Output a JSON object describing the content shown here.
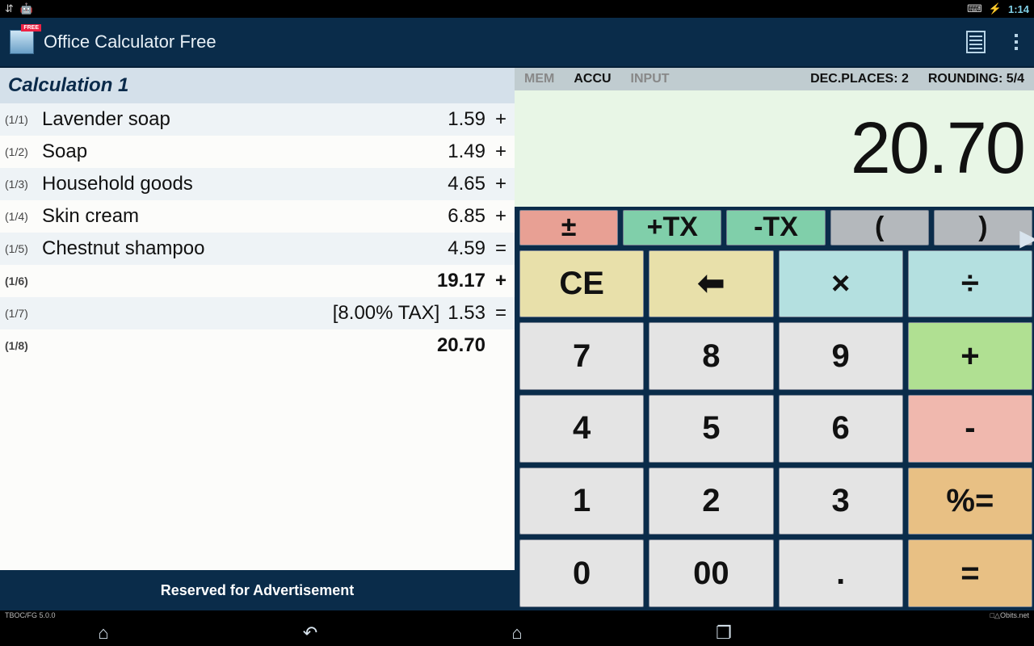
{
  "status": {
    "time": "1:14"
  },
  "appbar": {
    "title": "Office Calculator Free",
    "free_badge": "FREE"
  },
  "info": {
    "mem": "MEM",
    "accu": "ACCU",
    "input": "INPUT",
    "dec": "DEC.PLACES: 2",
    "rounding": "ROUNDING: 5/4"
  },
  "display": {
    "value": "20.70"
  },
  "tape": {
    "title": "Calculation 1",
    "rows": [
      {
        "idx": "(1/1)",
        "label": "Lavender soap",
        "note": "",
        "value": "1.59",
        "op": "+",
        "bold": false
      },
      {
        "idx": "(1/2)",
        "label": "Soap",
        "note": "",
        "value": "1.49",
        "op": "+",
        "bold": false
      },
      {
        "idx": "(1/3)",
        "label": "Household goods",
        "note": "",
        "value": "4.65",
        "op": "+",
        "bold": false
      },
      {
        "idx": "(1/4)",
        "label": "Skin cream",
        "note": "",
        "value": "6.85",
        "op": "+",
        "bold": false
      },
      {
        "idx": "(1/5)",
        "label": "Chestnut shampoo",
        "note": "",
        "value": "4.59",
        "op": "=",
        "bold": false
      },
      {
        "idx": "(1/6)",
        "label": "",
        "note": "",
        "value": "19.17",
        "op": "+",
        "bold": true
      },
      {
        "idx": "(1/7)",
        "label": "",
        "note": "[8.00% TAX]",
        "value": "1.53",
        "op": "=",
        "bold": false
      },
      {
        "idx": "(1/8)",
        "label": "",
        "note": "",
        "value": "20.70",
        "op": "",
        "bold": true
      }
    ]
  },
  "ad": {
    "text": "Reserved for Advertisement"
  },
  "keys": {
    "pm": "±",
    "ptx": "+TX",
    "mtx": "-TX",
    "lparen": "(",
    "rparen": ")",
    "ce": "CE",
    "back": "⬅",
    "mul": "×",
    "div": "÷",
    "k7": "7",
    "k8": "8",
    "k9": "9",
    "plus": "+",
    "k4": "4",
    "k5": "5",
    "k6": "6",
    "minus": "-",
    "k1": "1",
    "k2": "2",
    "k3": "3",
    "pcteq": "%=",
    "k0": "0",
    "k00": "00",
    "dot": ".",
    "eq": "="
  },
  "footer": {
    "left": "TBOC/FG 5.0.0",
    "right": "□△Obits.net"
  }
}
